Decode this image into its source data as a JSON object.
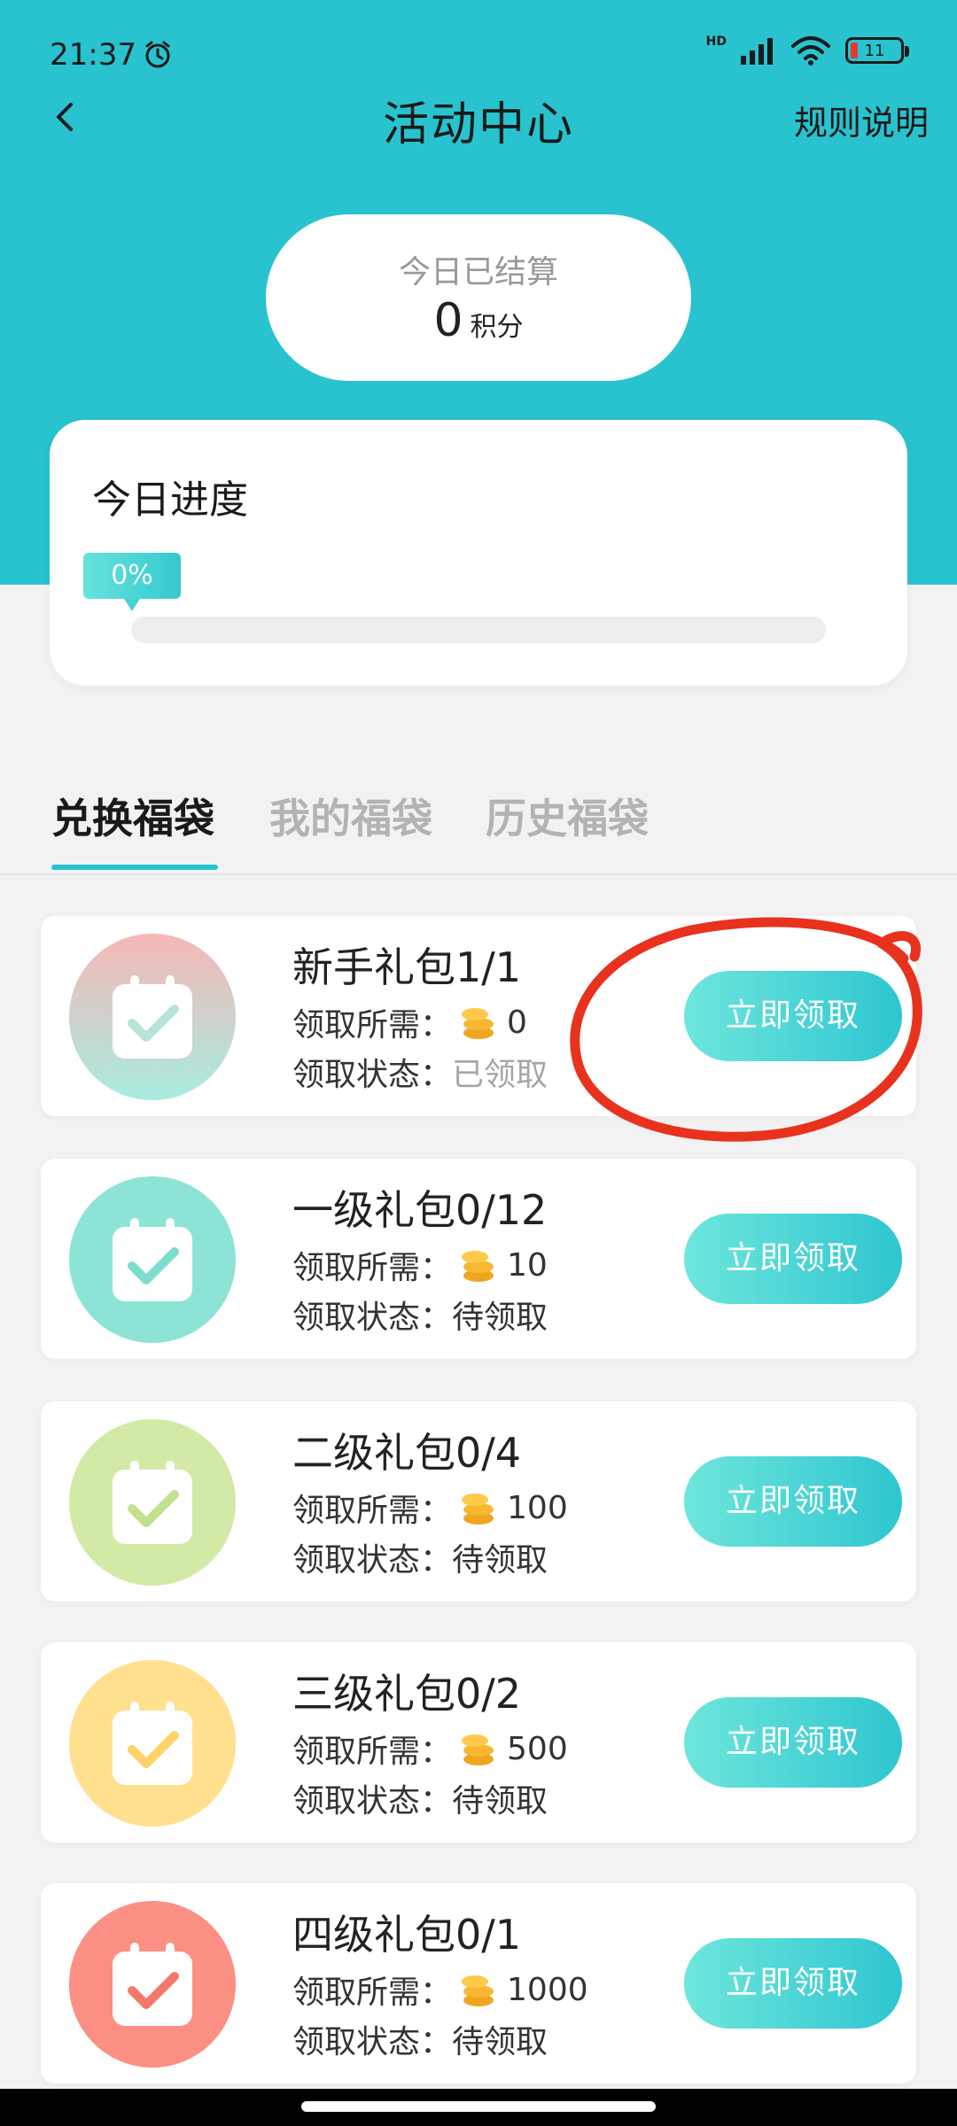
{
  "status_bar": {
    "time": "21:37",
    "network": "HD",
    "battery": "11"
  },
  "nav": {
    "title": "活动中心",
    "rules": "规则说明"
  },
  "settled": {
    "label": "今日已结算",
    "value": "0",
    "unit": "积分"
  },
  "progress": {
    "title": "今日进度",
    "percent_label": "0%",
    "fraction": 0
  },
  "tabs": [
    {
      "label": "兑换福袋",
      "active": true
    },
    {
      "label": "我的福袋",
      "active": false
    },
    {
      "label": "历史福袋",
      "active": false
    }
  ],
  "labels": {
    "required": "领取所需：",
    "status": "领取状态："
  },
  "gifts": [
    {
      "name": "新手礼包1/1",
      "cost": "0",
      "status": "已领取",
      "button": "立即领取",
      "color_top": "#f6b7b7",
      "color_bottom": "#a8ecdf",
      "check_color": "#b8e3d8"
    },
    {
      "name": "一级礼包0/12",
      "cost": "10",
      "status": "待领取",
      "button": "立即领取",
      "color_top": "#8de4d6",
      "color_bottom": "#8de4d6",
      "check_color": "#7ddccd"
    },
    {
      "name": "二级礼包0/4",
      "cost": "100",
      "status": "待领取",
      "button": "立即领取",
      "color_top": "#d3eaa6",
      "color_bottom": "#d3eaa6",
      "check_color": "#c2e08e"
    },
    {
      "name": "三级礼包0/2",
      "cost": "500",
      "status": "待领取",
      "button": "立即领取",
      "color_top": "#ffe08f",
      "color_bottom": "#ffe08f",
      "check_color": "#ffd36a"
    },
    {
      "name": "四级礼包0/1",
      "cost": "1000",
      "status": "待领取",
      "button": "立即领取",
      "color_top": "#fb8f83",
      "color_bottom": "#fb8f83",
      "check_color": "#f4786c"
    }
  ],
  "colors": {
    "accent": "#28c3cf",
    "annotation": "#e8321e"
  }
}
